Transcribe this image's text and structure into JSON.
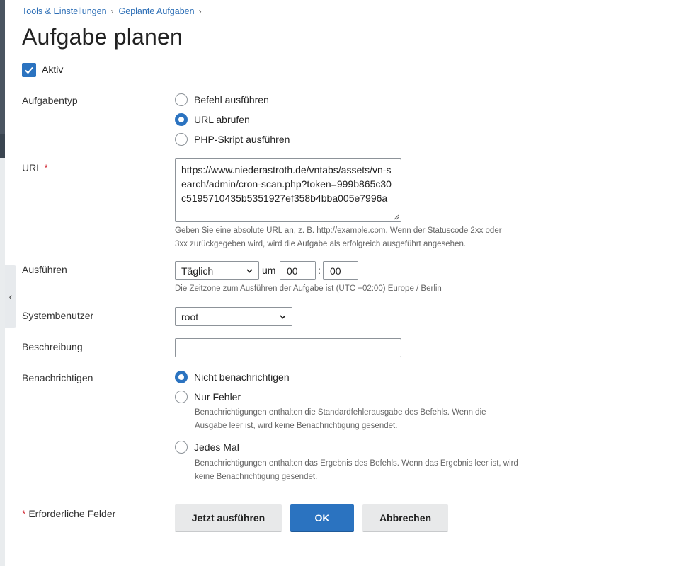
{
  "breadcrumb": {
    "items": [
      "Tools & Einstellungen",
      "Geplante Aufgaben"
    ],
    "separator": "›"
  },
  "page_title": "Aufgabe planen",
  "active": {
    "label": "Aktiv",
    "checked": true
  },
  "task_type": {
    "label": "Aufgabentyp",
    "options": [
      "Befehl ausführen",
      "URL abrufen",
      "PHP-Skript ausführen"
    ],
    "selected": "URL abrufen"
  },
  "url": {
    "label": "URL",
    "required_mark": "*",
    "value": "https://www.niederastroth.de/vntabs/assets/vn-search/admin/cron-scan.php?token=999b865c30c5195710435b5351927ef358b4bba005e7996a",
    "hint_line1": "Geben Sie eine absolute URL an, z. B. http://example.com. Wenn der Statuscode 2xx oder",
    "hint_line2": "3xx zurückgegeben wird, wird die Aufgabe als erfolgreich ausgeführt angesehen."
  },
  "schedule": {
    "label": "Ausführen",
    "frequency": "Täglich",
    "at_label": "um",
    "hour": "00",
    "colon": ":",
    "minute": "00",
    "hint": "Die Zeitzone zum Ausführen der Aufgabe ist (UTC +02:00) Europe / Berlin"
  },
  "system_user": {
    "label": "Systembenutzer",
    "value": "root"
  },
  "description": {
    "label": "Beschreibung",
    "value": ""
  },
  "notify": {
    "label": "Benachrichtigen",
    "options": [
      {
        "label": "Nicht benachrichtigen",
        "selected": true
      },
      {
        "label": "Nur Fehler",
        "selected": false,
        "hint_line1": "Benachrichtigungen enthalten die Standardfehlerausgabe des Befehls. Wenn die",
        "hint_line2": "Ausgabe leer ist, wird keine Benachrichtigung gesendet."
      },
      {
        "label": "Jedes Mal",
        "selected": false,
        "hint_line1": "Benachrichtigungen enthalten das Ergebnis des Befehls. Wenn das Ergebnis leer ist, wird",
        "hint_line2": "keine Benachrichtigung gesendet."
      }
    ]
  },
  "footer": {
    "required_mark": "*",
    "required_note": "Erforderliche Felder",
    "run_now": "Jetzt ausführen",
    "ok": "OK",
    "cancel": "Abbrechen"
  },
  "colors": {
    "accent": "#2b73c0",
    "link": "#2b6db5",
    "required": "#d0222e"
  },
  "icons": {
    "collapse": "chevron-left-icon",
    "check": "checkmark-icon",
    "select": "chevron-down-icon"
  }
}
